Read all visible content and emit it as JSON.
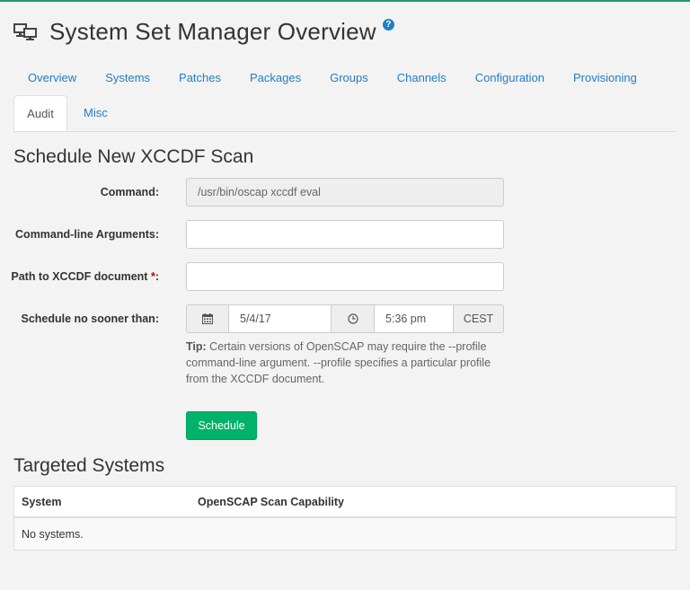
{
  "header": {
    "title": "System Set Manager Overview",
    "help_glyph": "?"
  },
  "tabs": {
    "row1": [
      "Overview",
      "Systems",
      "Patches",
      "Packages",
      "Groups",
      "Channels",
      "Configuration",
      "Provisioning"
    ],
    "active": "Audit",
    "misc": "Misc"
  },
  "form": {
    "heading": "Schedule New XCCDF Scan",
    "command_label": "Command:",
    "command_value": "/usr/bin/oscap xccdf eval",
    "args_label": "Command-line Arguments:",
    "args_value": "",
    "path_label": "Path to XCCDF document",
    "path_required": "*",
    "path_colon": ":",
    "path_value": "",
    "schedule_label": "Schedule no sooner than:",
    "date_value": "5/4/17",
    "time_value": "5:36 pm",
    "timezone": "CEST",
    "tip_bold": "Tip:",
    "tip_text": " Certain versions of OpenSCAP may require the --profile command-line argument. --profile specifies a particular profile from the XCCDF document.",
    "schedule_button": "Schedule"
  },
  "targeted": {
    "heading": "Targeted Systems",
    "columns": [
      "System",
      "OpenSCAP Scan Capability"
    ],
    "empty_text": "No systems."
  },
  "colors": {
    "accent_link": "#1f7ec8",
    "primary_button": "#00b26a",
    "top_border": "#1e9c6b",
    "required": "#cc0000"
  },
  "icons": [
    "system-set-icon",
    "help-icon",
    "calendar-icon",
    "clock-icon"
  ]
}
